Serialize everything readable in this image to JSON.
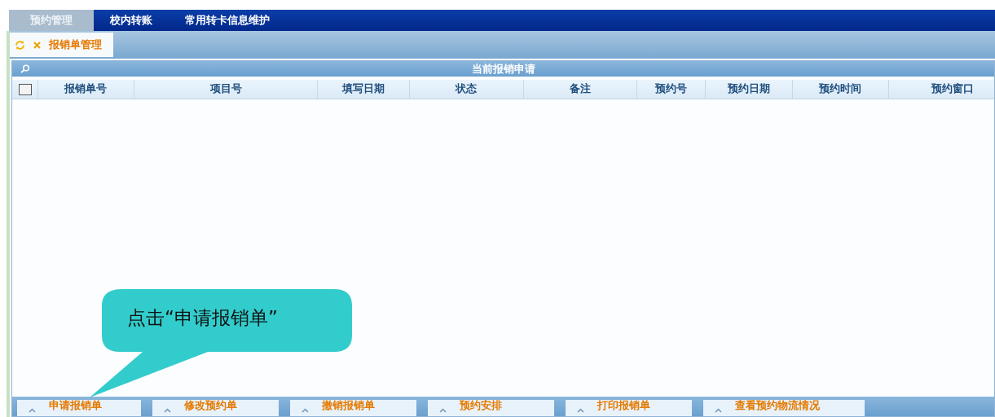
{
  "menu_tabs": [
    {
      "label": "预约管理",
      "selected": true
    },
    {
      "label": "校内转账",
      "selected": false
    },
    {
      "label": "常用转卡信息维护",
      "selected": false
    }
  ],
  "page_tabs": [
    {
      "label": "报销单管理",
      "selected": true
    }
  ],
  "panel": {
    "title": "当前报销申请",
    "table": {
      "select_all_checked": false,
      "columns": [
        "报销单号",
        "项目号",
        "填写日期",
        "状态",
        "备注",
        "预约号",
        "预约日期",
        "预约时间",
        "预约窗口"
      ]
    }
  },
  "toolbar": [
    {
      "label": "申请报销单"
    },
    {
      "label": "修改预约单"
    },
    {
      "label": "撤销报销单"
    },
    {
      "label": "预约安排"
    },
    {
      "label": "打印报销单"
    },
    {
      "label": "查看预约物流情况"
    }
  ],
  "callout": {
    "text": "点击“申请报销单”"
  }
}
